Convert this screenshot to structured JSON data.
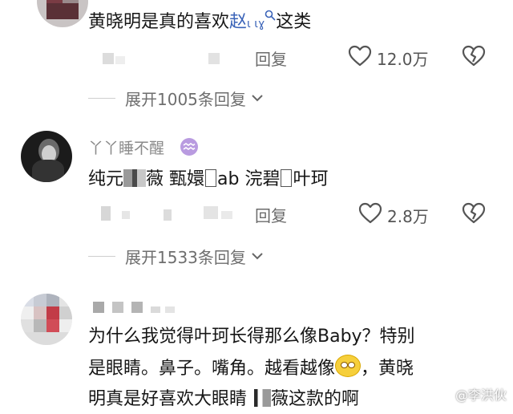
{
  "comments": [
    {
      "text_parts": [
        "黄晓明是真的喜欢",
        "赵",
        "这类"
      ],
      "reply_label": "回复",
      "likes": "12.0万",
      "expand": "展开1005条回复"
    },
    {
      "username": "丫丫睡不醒",
      "text_parts": [
        "纯元",
        "薇 甄嬛",
        "ab 浣碧",
        "叶珂"
      ],
      "reply_label": "回复",
      "likes": "2.8万",
      "expand": "展开1533条回复"
    },
    {
      "line1": "为什么我觉得叶珂长得那么像Baby？特别",
      "line2": "是眼睛。鼻子。嘴角。越看越像",
      "line2_tail": "，黄晓",
      "line3_a": "明真是好喜欢大眼睛",
      "line3_b": "薇这款的啊"
    }
  ],
  "watermark": "@李洪伙",
  "icons": {
    "like": "heart-outline-icon",
    "dislike": "broken-heart-icon",
    "expand": "chevron-down-icon",
    "zodiac": "aquarius-icon",
    "emoji": "grinning-face-emoji"
  }
}
